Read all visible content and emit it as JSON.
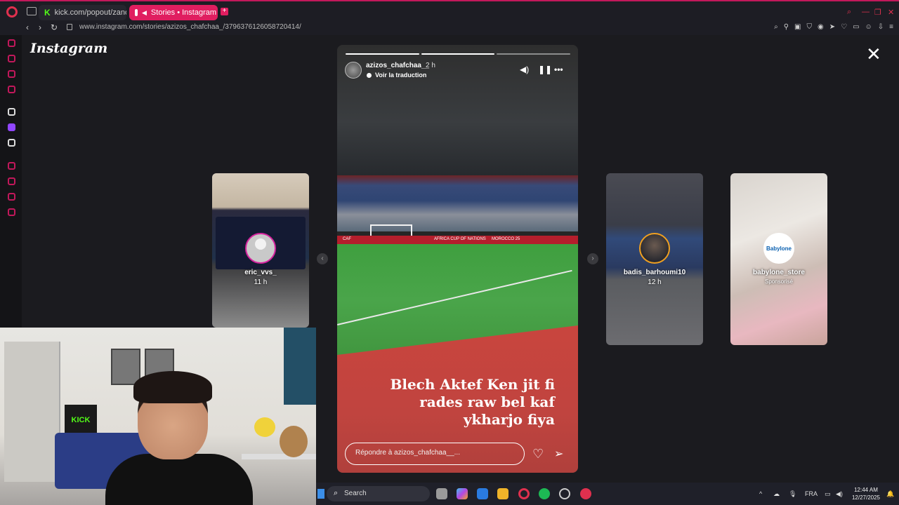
{
  "browser": {
    "tabs": [
      {
        "label": "kick.com/popout/zanoun",
        "active": false
      },
      {
        "label": "Stories • Instagram",
        "active": true
      }
    ],
    "new_tab_label": "+",
    "url": "www.instagram.com/stories/azizos_chafchaa_/3796376126058720414/",
    "accent_color": "#e01e60"
  },
  "instagram": {
    "logo": "Instagram",
    "close_label": "✕"
  },
  "main_story": {
    "username": "azizos_chafchaa__",
    "time": "2 h",
    "translate_label": "Voir la traduction",
    "progress_segments": 3,
    "progress_done": 2,
    "board_text_1": "AFRICA CUP OF NATIONS",
    "board_text_2": "MOROCCO 25",
    "board_text_3": "CAF",
    "caption_lines": [
      "Blech Aktef Ken jit fi",
      "rades raw bel kaf",
      "ykharjo fiya"
    ],
    "reply_placeholder": "Répondre à azizos_chafchaa__..."
  },
  "side_stories": [
    {
      "username": "eric_vvs_",
      "time": "11 h"
    },
    {
      "username": "badis_barhoumi10",
      "time": "12 h"
    },
    {
      "username": "babylone_store",
      "sub": "Sponsorisé",
      "brand": "Babylone"
    }
  ],
  "webcam": {
    "sign": "KICK"
  },
  "taskbar": {
    "search_label": "Search",
    "lang": "FRA",
    "time": "12:44 AM",
    "date": "12/27/2025"
  }
}
